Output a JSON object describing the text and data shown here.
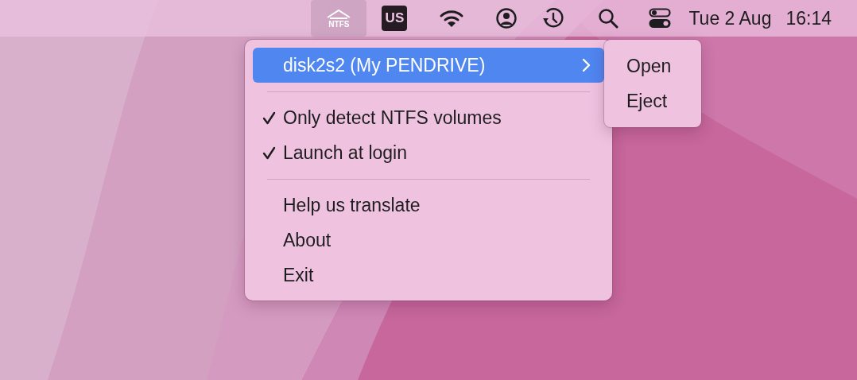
{
  "menu_bar": {
    "app_icon": {
      "label": "NTFS",
      "selected": true
    },
    "input_source": "US",
    "date": "Tue 2 Aug",
    "time": "16:14"
  },
  "menu": {
    "items": [
      {
        "kind": "submenu",
        "label": "disk2s2 (My PENDRIVE)",
        "selected": true
      },
      {
        "kind": "separator"
      },
      {
        "kind": "toggle",
        "label": "Only detect NTFS volumes",
        "checked": true
      },
      {
        "kind": "toggle",
        "label": "Launch at login",
        "checked": true
      },
      {
        "kind": "separator"
      },
      {
        "kind": "action",
        "label": "Help us translate"
      },
      {
        "kind": "action",
        "label": "About"
      },
      {
        "kind": "action",
        "label": "Exit"
      }
    ]
  },
  "submenu": {
    "items": [
      {
        "label": "Open"
      },
      {
        "label": "Eject"
      }
    ]
  }
}
